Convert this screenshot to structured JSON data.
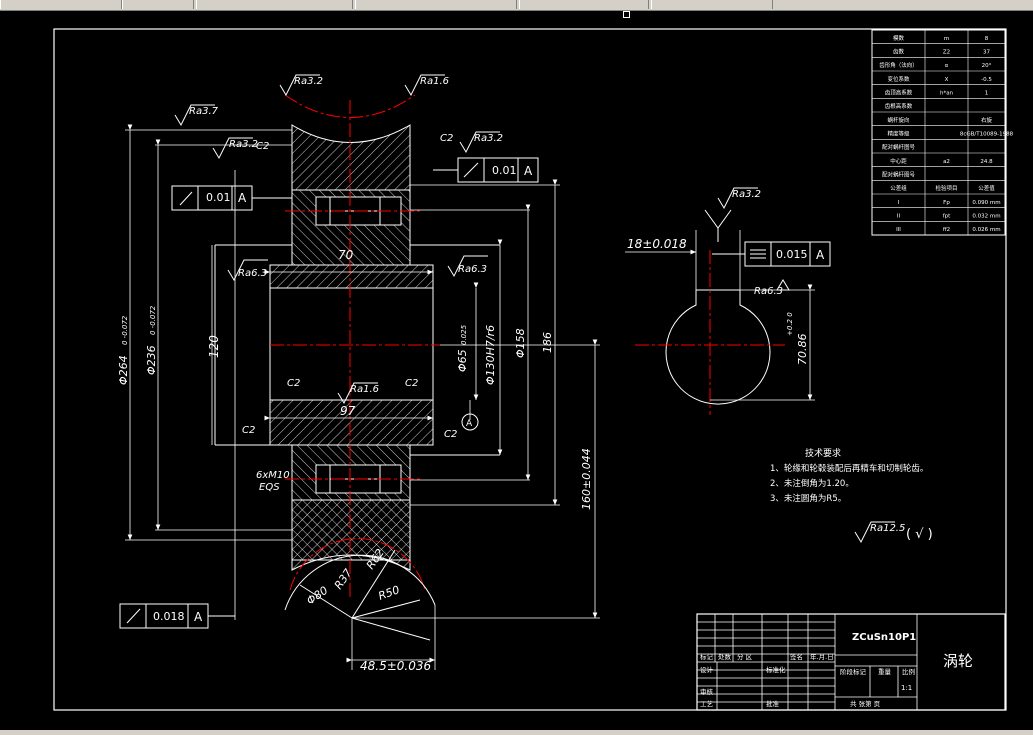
{
  "title_block": {
    "material": "ZCuSn10P1",
    "part_name": "涡轮",
    "scale": "1:1",
    "row_labels": [
      "标记",
      "处数",
      "分 区",
      "签名",
      "年.月.日"
    ],
    "design_label": "设计",
    "standardize_label": "标准化",
    "review_label": "审核",
    "process_label": "工艺",
    "approve_label": "批准",
    "stage_label": "阶段标记",
    "weight_label": "重量",
    "scale_label": "比例",
    "sheets_label": "共   张第   页"
  },
  "param_table": {
    "rows": [
      {
        "name": "模数",
        "sym": "m",
        "val": "8"
      },
      {
        "name": "齿数",
        "sym": "Z2",
        "val": "37"
      },
      {
        "name": "齿形角（法向）",
        "sym": "α",
        "val": "20°"
      },
      {
        "name": "变位系数",
        "sym": "X",
        "val": "-0.5"
      },
      {
        "name": "齿顶高系数",
        "sym": "h*an",
        "val": "1"
      },
      {
        "name": "齿根高系数",
        "sym": "",
        "val": ""
      },
      {
        "name": "蜗杆旋向",
        "sym": "",
        "val": "右旋"
      },
      {
        "name": "精度等级",
        "sym": "",
        "val": "8cGB/T10089-1988"
      },
      {
        "name": "配对蜗杆图号",
        "sym": "",
        "val": ""
      },
      {
        "name": "中心距",
        "sym": "a2",
        "val": "24.8"
      },
      {
        "name": "配对蜗杆图号",
        "sym": "",
        "val": ""
      },
      {
        "name": "公差组",
        "sym": "检验项目",
        "val": "公差值"
      },
      {
        "name": "I",
        "sym": "Fp",
        "val": "0.090 mm"
      },
      {
        "name": "II",
        "sym": "fpt",
        "val": "0.032 mm"
      },
      {
        "name": "III",
        "sym": "ff2",
        "val": "0.026 mm"
      }
    ]
  },
  "dimensions": {
    "d264": "Φ264",
    "d264_tol": "0 -0.072",
    "d236": "Φ236",
    "d236_tol": "0 -0.072",
    "d120": "120",
    "d70": "70",
    "d97": "97",
    "d65": "Φ65",
    "d65_tol": "0.025",
    "d130": "Φ130H7/r6",
    "d158": "Φ158",
    "d186": "186",
    "d160": "160±0.044",
    "d48": "48.5±0.036",
    "d80": "Φ80",
    "r37": "R37",
    "r62": "R62",
    "r50": "R50",
    "key_width": "18±0.018",
    "key_depth": "70.86",
    "key_depth_tol": "+0.2 0",
    "bolt": "6xM10",
    "bolt_eqs": "EQS"
  },
  "tolerances": {
    "runout1": "0.01",
    "runout1_datum": "A",
    "runout2": "0.01",
    "runout2_datum": "A",
    "runout3": "0.018",
    "runout3_datum": "A",
    "symmetry": "0.015",
    "symmetry_datum": "A",
    "datum": "A"
  },
  "roughness": {
    "ra32": "Ra3.2",
    "ra16": "Ra1.6",
    "ra37": "Ra3.7",
    "ra63": "Ra6.3",
    "ra125": "Ra12.5",
    "check": "( √ )"
  },
  "chamfer": "C2",
  "tech_req": {
    "title": "技术要求",
    "items": [
      "1、轮缘和轮毂装配后再精车和切制轮齿。",
      "2、未注倒角为1.20。",
      "3、未注圆角为R5。"
    ]
  },
  "colors": {
    "line": "#ffffff",
    "center": "#ff0000",
    "dim": "#ffffff"
  }
}
